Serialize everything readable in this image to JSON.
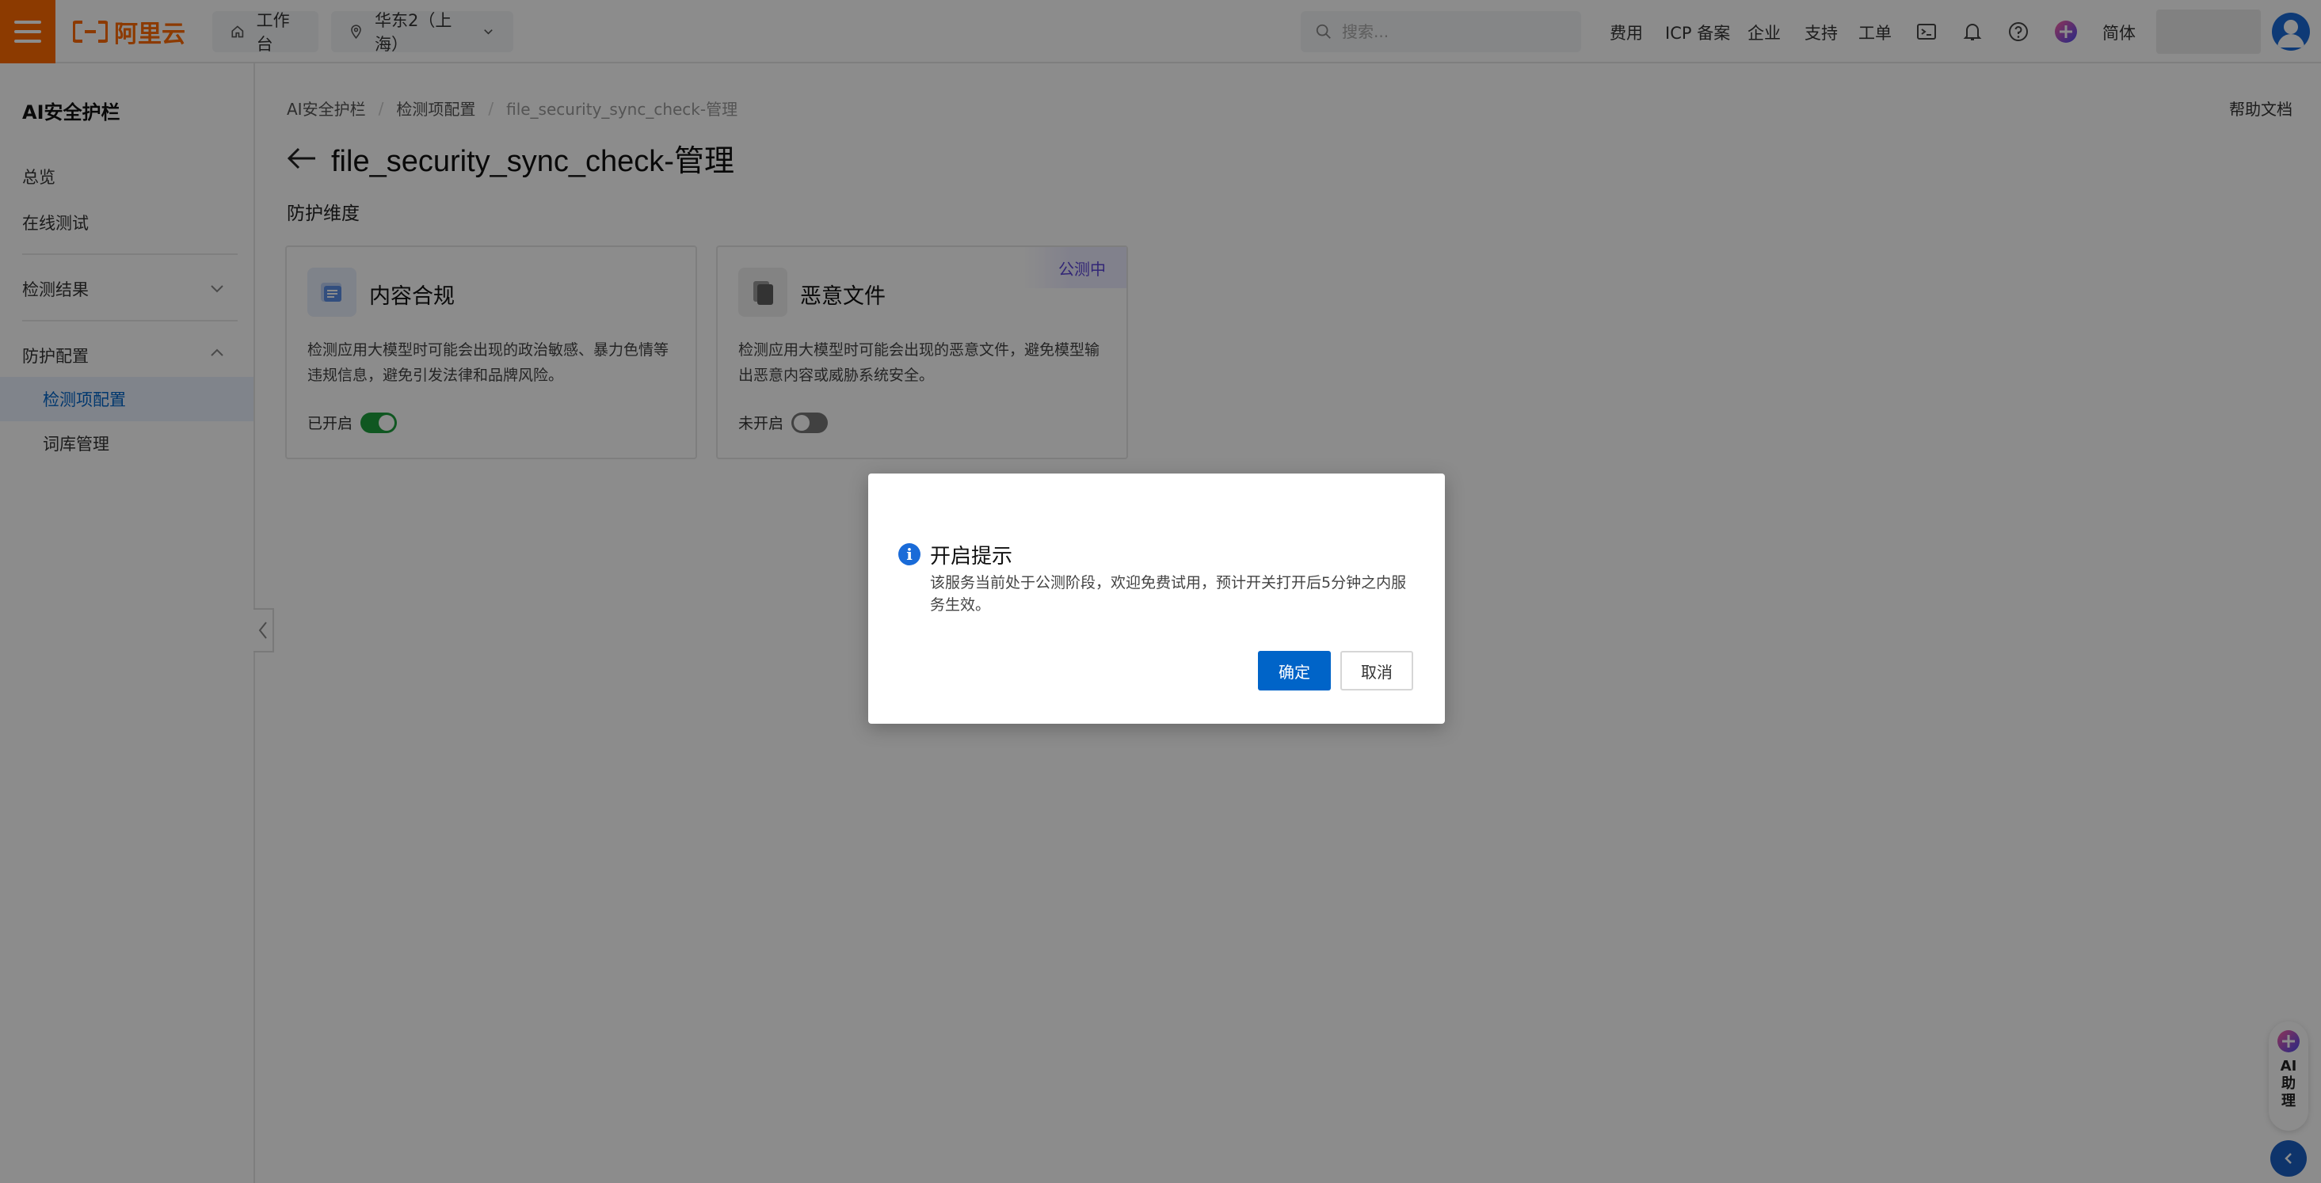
{
  "header": {
    "brand_text": "阿里云",
    "workbench_label": "工作台",
    "region_label": "华东2（上海）",
    "search_placeholder": "搜索...",
    "links": [
      "费用",
      "ICP 备案",
      "企业",
      "支持",
      "工单"
    ],
    "language": "简体",
    "icons": [
      "menu-icon",
      "home-icon",
      "location-pin-icon",
      "chevron-down-icon",
      "search-icon",
      "terminal-icon",
      "bell-icon",
      "help-icon",
      "ai-plus-icon",
      "user-avatar-icon"
    ],
    "accent_color": "#ff6a00"
  },
  "sidebar": {
    "title": "AI安全护栏",
    "items": {
      "overview": "总览",
      "online_test": "在线测试",
      "results": "检测结果",
      "protection_config": "防护配置",
      "detection_config": "检测项配置",
      "lexicon": "词库管理"
    }
  },
  "main": {
    "breadcrumb": [
      "AI安全护栏",
      "检测项配置",
      "file_security_sync_check-管理"
    ],
    "help_doc": "帮助文档",
    "title": "file_security_sync_check-管理",
    "section_label": "防护维度",
    "cards": [
      {
        "title": "内容合规",
        "desc": "检测应用大模型时可能会出现的政治敏感、暴力色情等违规信息，避免引发法律和品牌风险。",
        "status_label": "已开启",
        "enabled": true
      },
      {
        "title": "恶意文件",
        "desc": "检测应用大模型时可能会出现的恶意文件，避免模型输出恶意内容或威胁系统安全。",
        "status_label": "未开启",
        "enabled": false,
        "badge": "公测中"
      }
    ]
  },
  "ai_assistant": {
    "label": "AI助理"
  },
  "modal": {
    "title": "开启提示",
    "body": "该服务当前处于公测阶段，欢迎免费试用，预计开关打开后5分钟之内服务生效。",
    "confirm": "确定",
    "cancel": "取消",
    "primary_color": "#0064c8"
  }
}
